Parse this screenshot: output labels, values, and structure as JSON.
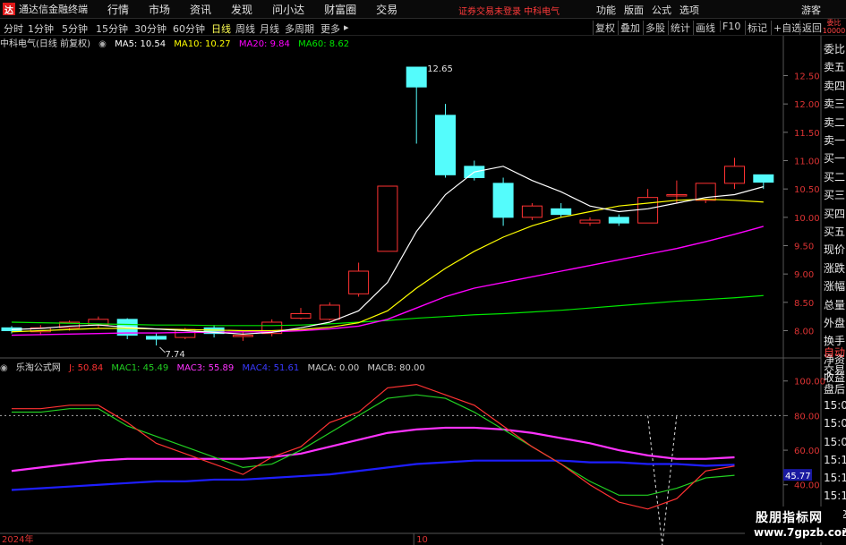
{
  "app": {
    "logo": "达",
    "title": "通达信金融终端"
  },
  "menus": [
    "行情",
    "市场",
    "资讯",
    "发现",
    "问小达",
    "财富圈",
    "交易"
  ],
  "notice": "证券交易未登录 中科电气",
  "right_menus": [
    "功能",
    "版面",
    "公式",
    "选项"
  ],
  "guest": "游客",
  "periods": [
    "分时",
    "1分钟",
    "5分钟",
    "15分钟",
    "30分钟",
    "60分钟",
    "日线",
    "周线",
    "月线",
    "多周期",
    "更多"
  ],
  "active_period": "日线",
  "toolbar": [
    "复权",
    "叠加",
    "多股",
    "统计",
    "画线",
    "F10",
    "标记",
    "+自选",
    "返回"
  ],
  "main_legend": {
    "stock": "中科电气(日线 前复权)",
    "ma5": "MA5: 10.54",
    "ma10": "MA10: 10.27",
    "ma20": "MA20: 9.84",
    "ma60": "MA60: 8.62"
  },
  "sub_legend": {
    "name": "乐淘公式网",
    "j": "J: 50.84",
    "mac1": "MAC1: 45.49",
    "mac3": "MAC3: 55.89",
    "mac4": "MAC4: 51.61",
    "maca": "MACA: 0.00",
    "macb": "MACB: 80.00"
  },
  "side_panel": [
    "委比",
    "卖五",
    "卖四",
    "卖三",
    "卖二",
    "卖一",
    "买一",
    "买二",
    "买三",
    "买四",
    "买五",
    "现价",
    "涨跌",
    "涨幅",
    "总量",
    "外盘",
    "换手",
    "净资",
    "收益"
  ],
  "side_panel_lower": [
    "自动",
    "交易",
    "盘后",
    "15:00",
    "15:05",
    "15:08",
    "15:13",
    "15:16",
    "15:19",
    "15:20",
    "15:22"
  ],
  "side_top": [
    "委比",
    "10000"
  ],
  "date_labels": [
    "2024年",
    "10"
  ],
  "price_marks": {
    "high": "12.65",
    "low": "7.74"
  },
  "sub_value_tag": "45.77",
  "watermark": {
    "line1": "股朋指标网",
    "line2": "www.7gpzb.com"
  },
  "colors": {
    "up": "#ff3232",
    "down": "#54fcfc",
    "ma5": "#ffffff",
    "ma10": "#ffff00",
    "ma20": "#ff00ff",
    "ma60": "#00e600",
    "j": "#ff3232",
    "mac1": "#22d022",
    "mac3": "#ff33ff",
    "mac4": "#1e1eff"
  },
  "chart_data": {
    "type": "candlestick",
    "main": {
      "ylim": [
        7.55,
        12.95
      ],
      "yticks": [
        8.0,
        8.5,
        9.0,
        9.5,
        10.0,
        10.5,
        11.0,
        11.5,
        12.0,
        12.5
      ],
      "candles": [
        {
          "o": 8.05,
          "h": 8.08,
          "l": 7.95,
          "c": 8.0
        },
        {
          "o": 7.98,
          "h": 8.1,
          "l": 7.92,
          "c": 8.05
        },
        {
          "o": 8.05,
          "h": 8.18,
          "l": 8.0,
          "c": 8.15
        },
        {
          "o": 8.1,
          "h": 8.25,
          "l": 8.05,
          "c": 8.2
        },
        {
          "o": 8.2,
          "h": 8.22,
          "l": 7.85,
          "c": 7.92
        },
        {
          "o": 7.9,
          "h": 7.95,
          "l": 7.74,
          "c": 7.85
        },
        {
          "o": 7.88,
          "h": 8.05,
          "l": 7.85,
          "c": 8.02
        },
        {
          "o": 8.05,
          "h": 8.1,
          "l": 7.88,
          "c": 7.95
        },
        {
          "o": 7.9,
          "h": 7.98,
          "l": 7.82,
          "c": 7.92
        },
        {
          "o": 7.95,
          "h": 8.2,
          "l": 7.9,
          "c": 8.15
        },
        {
          "o": 8.22,
          "h": 8.4,
          "l": 8.2,
          "c": 8.3
        },
        {
          "o": 8.2,
          "h": 8.5,
          "l": 8.18,
          "c": 8.45
        },
        {
          "o": 8.65,
          "h": 9.2,
          "l": 8.6,
          "c": 9.05
        },
        {
          "o": 9.4,
          "h": 10.55,
          "l": 9.4,
          "c": 10.55
        },
        {
          "o": 12.65,
          "h": 12.65,
          "l": 11.3,
          "c": 12.3
        },
        {
          "o": 11.8,
          "h": 12.0,
          "l": 10.7,
          "c": 10.75
        },
        {
          "o": 10.9,
          "h": 11.0,
          "l": 10.65,
          "c": 10.7
        },
        {
          "o": 10.6,
          "h": 10.7,
          "l": 9.85,
          "c": 10.0
        },
        {
          "o": 10.0,
          "h": 10.25,
          "l": 9.95,
          "c": 10.2
        },
        {
          "o": 10.15,
          "h": 10.25,
          "l": 10.0,
          "c": 10.05
        },
        {
          "o": 9.9,
          "h": 10.0,
          "l": 9.85,
          "c": 9.95
        },
        {
          "o": 10.0,
          "h": 10.05,
          "l": 9.85,
          "c": 9.9
        },
        {
          "o": 9.9,
          "h": 10.5,
          "l": 9.9,
          "c": 10.35
        },
        {
          "o": 10.4,
          "h": 10.65,
          "l": 10.25,
          "c": 10.4
        },
        {
          "o": 10.3,
          "h": 10.6,
          "l": 10.25,
          "c": 10.6
        },
        {
          "o": 10.6,
          "h": 11.05,
          "l": 10.5,
          "c": 10.9
        },
        {
          "o": 10.75,
          "h": 10.75,
          "l": 10.5,
          "c": 10.62
        }
      ],
      "ma5": [
        8.02,
        8.04,
        8.08,
        8.1,
        8.06,
        8.03,
        8.0,
        7.97,
        7.94,
        7.97,
        8.05,
        8.15,
        8.35,
        8.85,
        9.75,
        10.4,
        10.8,
        10.9,
        10.65,
        10.45,
        10.2,
        10.1,
        10.15,
        10.25,
        10.35,
        10.4,
        10.54
      ],
      "ma10": [
        7.98,
        8.0,
        8.02,
        8.04,
        8.04,
        8.03,
        8.02,
        8.01,
        8.0,
        8.0,
        8.02,
        8.06,
        8.14,
        8.35,
        8.75,
        9.1,
        9.4,
        9.65,
        9.85,
        10.0,
        10.1,
        10.2,
        10.25,
        10.3,
        10.32,
        10.3,
        10.27
      ],
      "ma20": [
        7.92,
        7.93,
        7.94,
        7.95,
        7.96,
        7.96,
        7.97,
        7.97,
        7.98,
        7.98,
        8.0,
        8.03,
        8.08,
        8.2,
        8.4,
        8.6,
        8.75,
        8.85,
        8.95,
        9.05,
        9.15,
        9.25,
        9.35,
        9.45,
        9.57,
        9.7,
        9.84
      ],
      "ma60": [
        8.15,
        8.14,
        8.13,
        8.12,
        8.11,
        8.1,
        8.1,
        8.09,
        8.09,
        8.09,
        8.1,
        8.12,
        8.15,
        8.18,
        8.22,
        8.25,
        8.28,
        8.3,
        8.33,
        8.36,
        8.4,
        8.44,
        8.48,
        8.52,
        8.55,
        8.58,
        8.62
      ]
    },
    "sub": {
      "ylim": [
        14,
        104
      ],
      "yticks": [
        20.0,
        40.0,
        60.0,
        80.0,
        100.0
      ],
      "ref_line": 80,
      "j": [
        84,
        84,
        86,
        86,
        76,
        64,
        58,
        52,
        46,
        56,
        62,
        76,
        82,
        96,
        98,
        92,
        86,
        74,
        62,
        52,
        40,
        30,
        26,
        32,
        48,
        50.84
      ],
      "mac1": [
        82,
        82,
        84,
        84,
        74,
        68,
        62,
        56,
        50,
        52,
        60,
        70,
        80,
        90,
        92,
        90,
        82,
        72,
        62,
        52,
        42,
        34,
        34,
        38,
        44,
        45.49
      ],
      "mac3": [
        48,
        50,
        52,
        54,
        55,
        55,
        55,
        55,
        55,
        56,
        58,
        62,
        66,
        70,
        72,
        73,
        73,
        72,
        70,
        67,
        64,
        60,
        57,
        55,
        55,
        55.89
      ],
      "mac4": [
        37,
        38,
        39,
        40,
        41,
        42,
        42,
        43,
        43,
        44,
        45,
        46,
        48,
        50,
        52,
        53,
        54,
        54,
        54,
        54,
        53,
        53,
        52,
        52,
        51,
        51.61
      ],
      "spike_days": [
        22,
        23
      ],
      "spike_from": 80,
      "spike_to": 5,
      "x_date_ticks": [
        {
          "index": 0,
          "label": "2024年"
        },
        {
          "index": 14,
          "label": "10"
        }
      ]
    }
  }
}
